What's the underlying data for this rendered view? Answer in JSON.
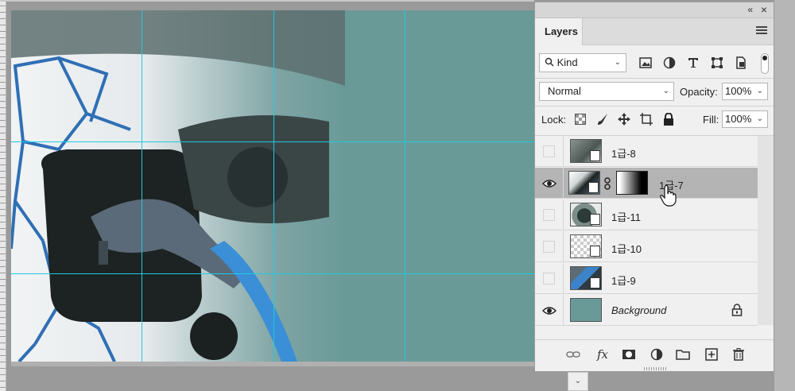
{
  "panel": {
    "title_tab": "Layers",
    "collapse_glyph": "«",
    "close_glyph": "×",
    "filter": {
      "kind_label": "Kind"
    },
    "blend_mode": "Normal",
    "opacity_label": "Opacity:",
    "opacity_value": "100%",
    "lock_label": "Lock:",
    "fill_label": "Fill:",
    "fill_value": "100%",
    "layers": [
      {
        "name": "1급-8",
        "visible": false,
        "selected": false,
        "smart_object": true,
        "mask": false
      },
      {
        "name": "1급-7",
        "visible": true,
        "selected": true,
        "smart_object": true,
        "mask": true
      },
      {
        "name": "1급-11",
        "visible": false,
        "selected": false,
        "smart_object": true,
        "mask": false
      },
      {
        "name": "1급-10",
        "visible": false,
        "selected": false,
        "smart_object": true,
        "mask": false
      },
      {
        "name": "1급-9",
        "visible": false,
        "selected": false,
        "smart_object": true,
        "mask": false
      },
      {
        "name": "Background",
        "visible": true,
        "selected": false,
        "smart_object": false,
        "locked": true
      }
    ],
    "bottom_icons": [
      "link-icon",
      "fx-icon",
      "mask-icon",
      "adjustment-icon",
      "folder-icon",
      "new-layer-icon",
      "trash-icon"
    ],
    "fx_label": "fx"
  },
  "colors": {
    "canvas_bg": "#6a9a98",
    "guide": "#1ecbe1",
    "selected_row": "#b4b4b4",
    "panel_bg": "#f0f0f0"
  }
}
